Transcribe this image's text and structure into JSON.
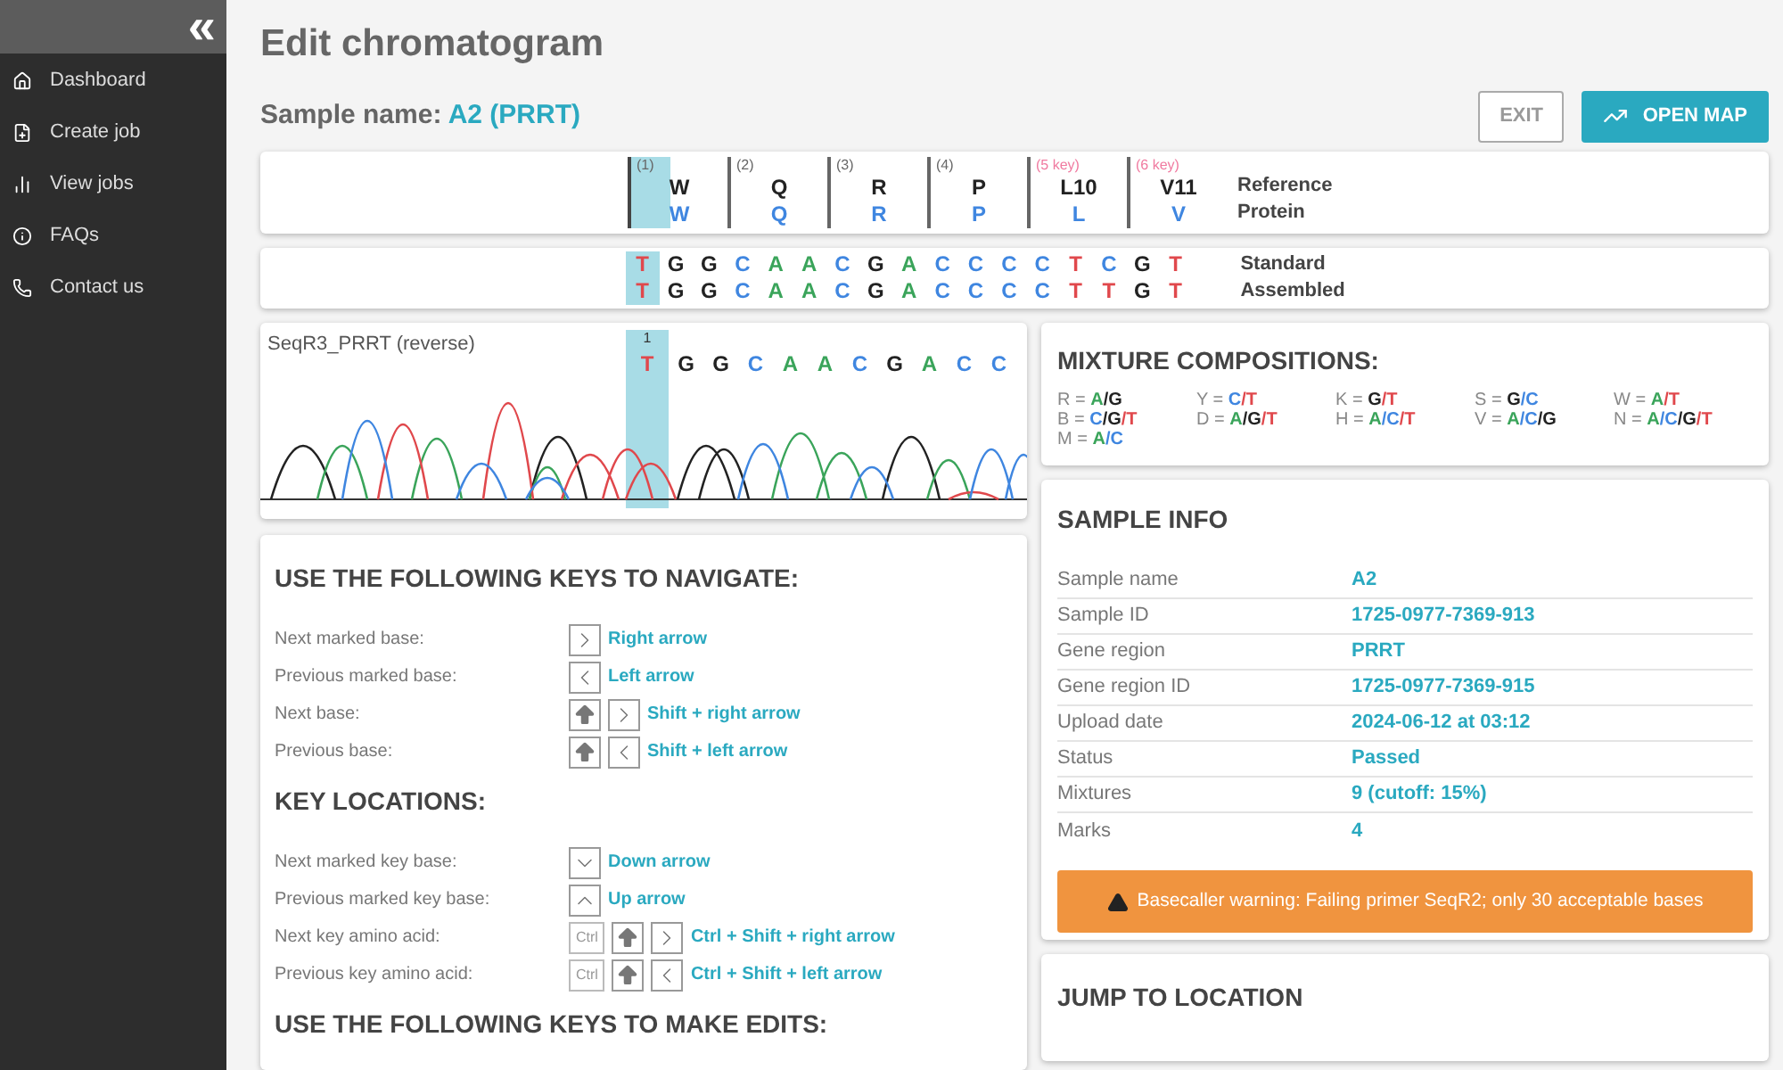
{
  "sidebar": {
    "collapse_icon": "«",
    "items": [
      {
        "label": "Dashboard",
        "selected": false
      },
      {
        "label": "Create job",
        "selected": false
      },
      {
        "label": "View jobs",
        "selected": false
      },
      {
        "label": "FAQs",
        "selected": false
      },
      {
        "label": "Contact us",
        "selected": false
      }
    ]
  },
  "page_title": "Edit chromatogram",
  "sample_name": {
    "label": "Sample name:",
    "value": "A2 (PRRT)"
  },
  "buttons": [
    {
      "label": "EXIT",
      "kind": "outline"
    },
    {
      "label": "OPEN MAP",
      "kind": "primary"
    }
  ],
  "reference": {
    "row_labels": [
      "Reference",
      "Protein"
    ],
    "columns": [
      {
        "position": "(1)",
        "key": false,
        "reference": "W",
        "protein": "W",
        "selected": true
      },
      {
        "position": "(2)",
        "key": false,
        "reference": "Q",
        "protein": "Q",
        "selected": false
      },
      {
        "position": "(3)",
        "key": false,
        "reference": "R",
        "protein": "R",
        "selected": false
      },
      {
        "position": "(4)",
        "key": false,
        "reference": "P",
        "protein": "P",
        "selected": false
      },
      {
        "position": "(5 key)",
        "key": true,
        "reference": "L10",
        "protein": "L",
        "selected": false
      },
      {
        "position": "(6 key)",
        "key": true,
        "reference": "V11",
        "protein": "V",
        "selected": false
      }
    ]
  },
  "sequences": {
    "rows": [
      {
        "label": "Standard",
        "bases": [
          {
            "base": "T",
            "color": "#e0484c",
            "selected": true
          },
          {
            "base": "G",
            "color": "#222222",
            "selected": false
          },
          {
            "base": "G",
            "color": "#222222",
            "selected": false
          },
          {
            "base": "C",
            "color": "#3f86e0",
            "selected": false
          },
          {
            "base": "A",
            "color": "#3aa45a",
            "selected": false
          },
          {
            "base": "A",
            "color": "#3aa45a",
            "selected": false
          },
          {
            "base": "C",
            "color": "#3f86e0",
            "selected": false
          },
          {
            "base": "G",
            "color": "#222222",
            "selected": false
          },
          {
            "base": "A",
            "color": "#3aa45a",
            "selected": false
          },
          {
            "base": "C",
            "color": "#3f86e0",
            "selected": false
          },
          {
            "base": "C",
            "color": "#3f86e0",
            "selected": false
          },
          {
            "base": "C",
            "color": "#3f86e0",
            "selected": false
          },
          {
            "base": "C",
            "color": "#3f86e0",
            "selected": false
          },
          {
            "base": "T",
            "color": "#e0484c",
            "selected": false
          },
          {
            "base": "C",
            "color": "#3f86e0",
            "selected": false
          },
          {
            "base": "G",
            "color": "#222222",
            "selected": false
          },
          {
            "base": "T",
            "color": "#e0484c",
            "selected": false
          }
        ]
      },
      {
        "label": "Assembled",
        "bases": [
          {
            "base": "T",
            "color": "#e0484c",
            "selected": true
          },
          {
            "base": "G",
            "color": "#222222",
            "selected": false
          },
          {
            "base": "G",
            "color": "#222222",
            "selected": false
          },
          {
            "base": "C",
            "color": "#3f86e0",
            "selected": false
          },
          {
            "base": "A",
            "color": "#3aa45a",
            "selected": false
          },
          {
            "base": "A",
            "color": "#3aa45a",
            "selected": false
          },
          {
            "base": "C",
            "color": "#3f86e0",
            "selected": false
          },
          {
            "base": "G",
            "color": "#222222",
            "selected": false
          },
          {
            "base": "A",
            "color": "#3aa45a",
            "selected": false
          },
          {
            "base": "C",
            "color": "#3f86e0",
            "selected": false
          },
          {
            "base": "C",
            "color": "#3f86e0",
            "selected": false
          },
          {
            "base": "C",
            "color": "#3f86e0",
            "selected": false
          },
          {
            "base": "C",
            "color": "#3f86e0",
            "selected": false
          },
          {
            "base": "T",
            "color": "#e0484c",
            "selected": false
          },
          {
            "base": "T",
            "color": "#e0484c",
            "selected": false
          },
          {
            "base": "G",
            "color": "#222222",
            "selected": false
          },
          {
            "base": "T",
            "color": "#e0484c",
            "selected": false
          }
        ]
      }
    ]
  },
  "chromatogram": {
    "title": "SeqR3_PRRT (reverse)",
    "marker": "1",
    "bases": [
      {
        "base": "T",
        "color": "#e0484c",
        "selected": true
      },
      {
        "base": "G",
        "color": "#222222",
        "selected": false
      },
      {
        "base": "G",
        "color": "#222222",
        "selected": false
      },
      {
        "base": "C",
        "color": "#3f86e0",
        "selected": false
      },
      {
        "base": "A",
        "color": "#3aa45a",
        "selected": false
      },
      {
        "base": "A",
        "color": "#3aa45a",
        "selected": false
      },
      {
        "base": "C",
        "color": "#3f86e0",
        "selected": false
      },
      {
        "base": "G",
        "color": "#222222",
        "selected": false
      },
      {
        "base": "A",
        "color": "#3aa45a",
        "selected": false
      },
      {
        "base": "C",
        "color": "#3f86e0",
        "selected": false
      },
      {
        "base": "C",
        "color": "#3f86e0",
        "selected": false
      }
    ]
  },
  "keys_panel": {
    "sections": [
      {
        "title": "USE THE FOLLOWING KEYS TO NAVIGATE:",
        "rows": [
          {
            "label": "Next marked base:",
            "keys": [
              {
                "kind": "right"
              }
            ],
            "action": "Right arrow"
          },
          {
            "label": "Previous marked base:",
            "keys": [
              {
                "kind": "left"
              }
            ],
            "action": "Left arrow"
          },
          {
            "label": "Next base:",
            "keys": [
              {
                "kind": "shift"
              },
              {
                "kind": "right"
              }
            ],
            "action": "Shift + right arrow"
          },
          {
            "label": "Previous base:",
            "keys": [
              {
                "kind": "shift"
              },
              {
                "kind": "left"
              }
            ],
            "action": "Shift + left arrow"
          }
        ]
      },
      {
        "title": "KEY LOCATIONS:",
        "rows": [
          {
            "label": "Next marked key base:",
            "keys": [
              {
                "kind": "down"
              }
            ],
            "action": "Down arrow"
          },
          {
            "label": "Previous marked key base:",
            "keys": [
              {
                "kind": "up"
              }
            ],
            "action": "Up arrow"
          },
          {
            "label": "Next key amino acid:",
            "keys": [
              {
                "kind": "ctrl",
                "label": "Ctrl"
              },
              {
                "kind": "shift"
              },
              {
                "kind": "right"
              }
            ],
            "action": "Ctrl + Shift + right arrow"
          },
          {
            "label": "Previous key amino acid:",
            "keys": [
              {
                "kind": "ctrl",
                "label": "Ctrl"
              },
              {
                "kind": "shift"
              },
              {
                "kind": "left"
              }
            ],
            "action": "Ctrl + Shift + left arrow"
          }
        ]
      },
      {
        "title": "USE THE FOLLOWING KEYS TO MAKE EDITS:"
      }
    ]
  },
  "mixtures": {
    "title": "MIXTURE COMPOSITIONS:",
    "items": [
      {
        "code": "R =",
        "parts": [
          {
            "base": "A",
            "color": "#3aa45a"
          },
          {
            "base": "/G",
            "color": "#222222"
          }
        ]
      },
      {
        "code": "Y =",
        "parts": [
          {
            "base": "C",
            "color": "#3f86e0"
          },
          {
            "base": "/T",
            "color": "#e0484c"
          }
        ]
      },
      {
        "code": "K =",
        "parts": [
          {
            "base": "G",
            "color": "#222222"
          },
          {
            "base": "/T",
            "color": "#e0484c"
          }
        ]
      },
      {
        "code": "S =",
        "parts": [
          {
            "base": "G",
            "color": "#222222"
          },
          {
            "base": "/C",
            "color": "#3f86e0"
          }
        ]
      },
      {
        "code": "W =",
        "parts": [
          {
            "base": "A",
            "color": "#3aa45a"
          },
          {
            "base": "/T",
            "color": "#e0484c"
          }
        ]
      },
      {
        "code": "B =",
        "parts": [
          {
            "base": "C",
            "color": "#3f86e0"
          },
          {
            "base": "/G",
            "color": "#222222"
          },
          {
            "base": "/T",
            "color": "#e0484c"
          }
        ]
      },
      {
        "code": "D =",
        "parts": [
          {
            "base": "A",
            "color": "#3aa45a"
          },
          {
            "base": "/G",
            "color": "#222222"
          },
          {
            "base": "/T",
            "color": "#e0484c"
          }
        ]
      },
      {
        "code": "H =",
        "parts": [
          {
            "base": "A",
            "color": "#3aa45a"
          },
          {
            "base": "/C",
            "color": "#3f86e0"
          },
          {
            "base": "/T",
            "color": "#e0484c"
          }
        ]
      },
      {
        "code": "V =",
        "parts": [
          {
            "base": "A",
            "color": "#3aa45a"
          },
          {
            "base": "/C",
            "color": "#3f86e0"
          },
          {
            "base": "/G",
            "color": "#222222"
          }
        ]
      },
      {
        "code": "N =",
        "parts": [
          {
            "base": "A",
            "color": "#3aa45a"
          },
          {
            "base": "/C",
            "color": "#3f86e0"
          },
          {
            "base": "/G",
            "color": "#222222"
          },
          {
            "base": "/T",
            "color": "#e0484c"
          }
        ]
      },
      {
        "code": "M =",
        "parts": [
          {
            "base": "A",
            "color": "#3aa45a"
          },
          {
            "base": "/C",
            "color": "#3f86e0"
          }
        ]
      }
    ]
  },
  "sample_info": {
    "title": "SAMPLE INFO",
    "rows": [
      {
        "label": "Sample name",
        "value": "A2"
      },
      {
        "label": "Sample ID",
        "value": "1725-0977-7369-913"
      },
      {
        "label": "Gene region",
        "value": "PRRT"
      },
      {
        "label": "Gene region ID",
        "value": "1725-0977-7369-915"
      },
      {
        "label": "Upload date",
        "value": "2024-06-12 at 03:12"
      },
      {
        "label": "Status",
        "value": "Passed"
      },
      {
        "label": "Mixtures",
        "value": "9 (cutoff: 15%)"
      },
      {
        "label": "Marks",
        "value": "4"
      }
    ],
    "warning": "Basecaller warning: Failing primer SeqR2; only 30 acceptable bases"
  },
  "jump": {
    "title": "JUMP TO LOCATION"
  }
}
